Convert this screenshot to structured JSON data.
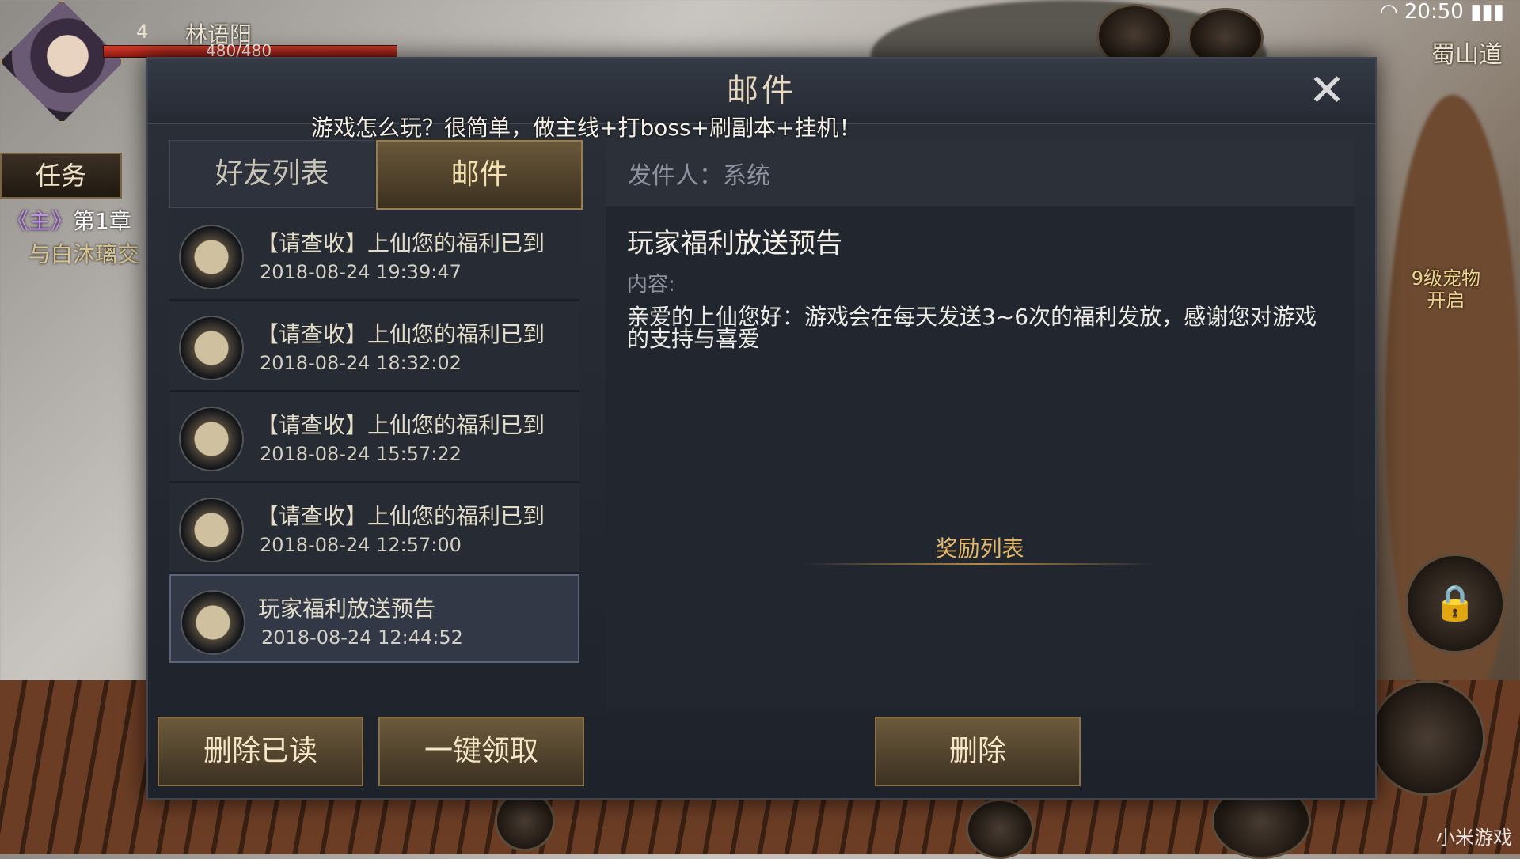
{
  "hud": {
    "player_level": "4",
    "player_name": "林语阳",
    "hp_text": "480/480",
    "quest_tab": "任务",
    "quest_tag": "《主》",
    "quest_chapter": "第1章",
    "quest_desc": "与白沐璃交",
    "time": "20:50",
    "location": "蜀山道",
    "pet_unlock_line1": "9级宠物",
    "pet_unlock_line2": "开启",
    "watermark": "小米游戏"
  },
  "dialog": {
    "title": "邮件",
    "close_icon": "close-icon",
    "tabs": [
      {
        "label": "好友列表",
        "active": false
      },
      {
        "label": "邮件",
        "active": true
      }
    ],
    "mails": [
      {
        "subject": "【请查收】上仙您的福利已到",
        "date": "2018-08-24 19:39:47",
        "icon": "scroll-icon"
      },
      {
        "subject": "【请查收】上仙您的福利已到",
        "date": "2018-08-24 18:32:02",
        "icon": "scroll-icon"
      },
      {
        "subject": "【请查收】上仙您的福利已到",
        "date": "2018-08-24 15:57:22",
        "icon": "scroll-icon"
      },
      {
        "subject": "【请查收】上仙您的福利已到",
        "date": "2018-08-24 12:57:00",
        "icon": "scroll-icon"
      },
      {
        "subject": "玩家福利放送预告",
        "date": "2018-08-24 12:44:52",
        "icon": "scroll-icon",
        "selected": true
      }
    ],
    "buttons": {
      "delete_read": "删除已读",
      "claim_all": "一键领取",
      "delete": "删除"
    },
    "detail": {
      "sender": "发件人：系统",
      "title": "玩家福利放送预告",
      "content_label": "内容:",
      "content": "亲爱的上仙您好：游戏会在每天发送3~6次的福利发放，感谢您对游戏的支持与喜爱",
      "reward_title": "奖励列表"
    },
    "tip": "游戏怎么玩？很简单，做主线+打boss+刷副本+挂机！"
  },
  "colors": {
    "accent_gold": "#e6b968",
    "button_bg": "#6d5a3c",
    "dialog_bg": "#1e222a"
  }
}
